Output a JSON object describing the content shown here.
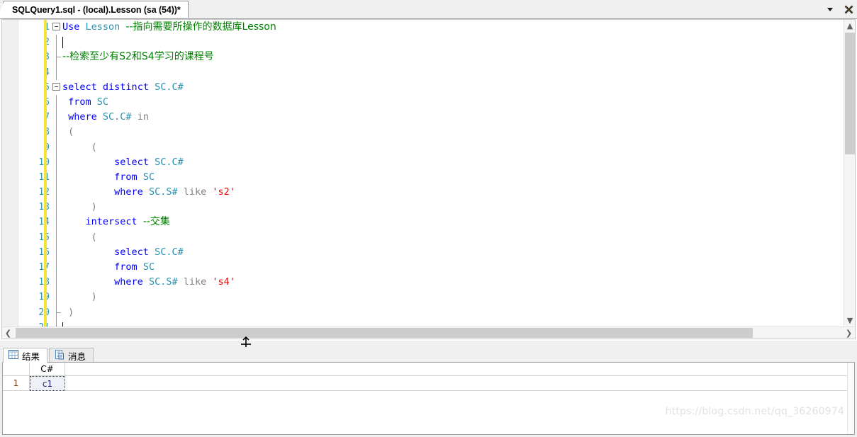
{
  "window": {
    "tab_title": "SQLQuery1.sql - (local).Lesson (sa (54))*",
    "chevron_icon": "chevron-down-icon",
    "close_icon": "close-icon"
  },
  "editor": {
    "lines": [
      {
        "num": "1",
        "glyph": "collapse-expanded",
        "tokens": [
          {
            "t": "Use",
            "c": "kw"
          },
          {
            "t": " ",
            "c": "plain"
          },
          {
            "t": "Lesson",
            "c": "ident"
          },
          {
            "t": " ",
            "c": "plain"
          },
          {
            "t": "--指向需要所操作的数据库Lesson",
            "c": "cmt"
          }
        ]
      },
      {
        "num": "2",
        "glyph": "line",
        "tokens": []
      },
      {
        "num": "3",
        "glyph": "tick",
        "tokens": [
          {
            "t": "--检索至少有S2和S4学习的课程号",
            "c": "cmt"
          }
        ]
      },
      {
        "num": "4",
        "glyph": "line",
        "tokens": []
      },
      {
        "num": "5",
        "glyph": "collapse-expanded",
        "tokens": [
          {
            "t": "select",
            "c": "kw"
          },
          {
            "t": " ",
            "c": "plain"
          },
          {
            "t": "distinct",
            "c": "kw"
          },
          {
            "t": " ",
            "c": "plain"
          },
          {
            "t": "SC.C#",
            "c": "ident"
          }
        ]
      },
      {
        "num": "6",
        "glyph": "line",
        "tokens": [
          {
            "t": " ",
            "c": "plain"
          },
          {
            "t": "from",
            "c": "kw"
          },
          {
            "t": " ",
            "c": "plain"
          },
          {
            "t": "SC",
            "c": "ident"
          }
        ]
      },
      {
        "num": "7",
        "glyph": "line",
        "tokens": [
          {
            "t": " ",
            "c": "plain"
          },
          {
            "t": "where",
            "c": "kw"
          },
          {
            "t": " ",
            "c": "plain"
          },
          {
            "t": "SC.C#",
            "c": "ident"
          },
          {
            "t": " ",
            "c": "plain"
          },
          {
            "t": "in",
            "c": "op"
          }
        ]
      },
      {
        "num": "8",
        "glyph": "line",
        "tokens": [
          {
            "t": " (",
            "c": "op"
          }
        ]
      },
      {
        "num": "9",
        "glyph": "line",
        "tokens": [
          {
            "t": "     (",
            "c": "op"
          }
        ]
      },
      {
        "num": "10",
        "glyph": "line",
        "tokens": [
          {
            "t": "         ",
            "c": "plain"
          },
          {
            "t": "select",
            "c": "kw"
          },
          {
            "t": " ",
            "c": "plain"
          },
          {
            "t": "SC.C#",
            "c": "ident"
          }
        ]
      },
      {
        "num": "11",
        "glyph": "line",
        "tokens": [
          {
            "t": "         ",
            "c": "plain"
          },
          {
            "t": "from",
            "c": "kw"
          },
          {
            "t": " ",
            "c": "plain"
          },
          {
            "t": "SC",
            "c": "ident"
          }
        ]
      },
      {
        "num": "12",
        "glyph": "line",
        "tokens": [
          {
            "t": "         ",
            "c": "plain"
          },
          {
            "t": "where",
            "c": "kw"
          },
          {
            "t": " ",
            "c": "plain"
          },
          {
            "t": "SC.S#",
            "c": "ident"
          },
          {
            "t": " ",
            "c": "plain"
          },
          {
            "t": "like",
            "c": "op"
          },
          {
            "t": " ",
            "c": "plain"
          },
          {
            "t": "'s2'",
            "c": "str"
          }
        ]
      },
      {
        "num": "13",
        "glyph": "line",
        "tokens": [
          {
            "t": "     )",
            "c": "op"
          }
        ]
      },
      {
        "num": "14",
        "glyph": "line",
        "tokens": [
          {
            "t": "    ",
            "c": "plain"
          },
          {
            "t": "intersect",
            "c": "kw"
          },
          {
            "t": " ",
            "c": "plain"
          },
          {
            "t": "--交集",
            "c": "cmt"
          }
        ]
      },
      {
        "num": "15",
        "glyph": "line",
        "tokens": [
          {
            "t": "     (",
            "c": "op"
          }
        ]
      },
      {
        "num": "16",
        "glyph": "line",
        "tokens": [
          {
            "t": "         ",
            "c": "plain"
          },
          {
            "t": "select",
            "c": "kw"
          },
          {
            "t": " ",
            "c": "plain"
          },
          {
            "t": "SC.C#",
            "c": "ident"
          }
        ]
      },
      {
        "num": "17",
        "glyph": "line",
        "tokens": [
          {
            "t": "         ",
            "c": "plain"
          },
          {
            "t": "from",
            "c": "kw"
          },
          {
            "t": " ",
            "c": "plain"
          },
          {
            "t": "SC",
            "c": "ident"
          }
        ]
      },
      {
        "num": "18",
        "glyph": "line",
        "tokens": [
          {
            "t": "         ",
            "c": "plain"
          },
          {
            "t": "where",
            "c": "kw"
          },
          {
            "t": " ",
            "c": "plain"
          },
          {
            "t": "SC.S#",
            "c": "ident"
          },
          {
            "t": " ",
            "c": "plain"
          },
          {
            "t": "like",
            "c": "op"
          },
          {
            "t": " ",
            "c": "plain"
          },
          {
            "t": "'s4'",
            "c": "str"
          }
        ]
      },
      {
        "num": "19",
        "glyph": "line",
        "tokens": [
          {
            "t": "     )",
            "c": "op"
          }
        ]
      },
      {
        "num": "20",
        "glyph": "tick",
        "tokens": [
          {
            "t": " )",
            "c": "op"
          }
        ]
      },
      {
        "num": "21",
        "glyph": "line",
        "tokens": []
      }
    ]
  },
  "editor_scrollbars": {
    "v_up_arrow": "▲",
    "v_down_arrow": "▼",
    "h_left_arrow": "❮",
    "h_right_arrow": "❯"
  },
  "results": {
    "tabs": [
      {
        "label": "结果",
        "icon": "grid-icon",
        "active": true
      },
      {
        "label": "消息",
        "icon": "message-icon",
        "active": false
      }
    ],
    "grid": {
      "columns": [
        "C#"
      ],
      "rows": [
        {
          "rownum": "1",
          "cells": [
            "c1"
          ]
        }
      ]
    }
  },
  "watermark": {
    "text": "https://blog.csdn.net/qq_36260974"
  }
}
